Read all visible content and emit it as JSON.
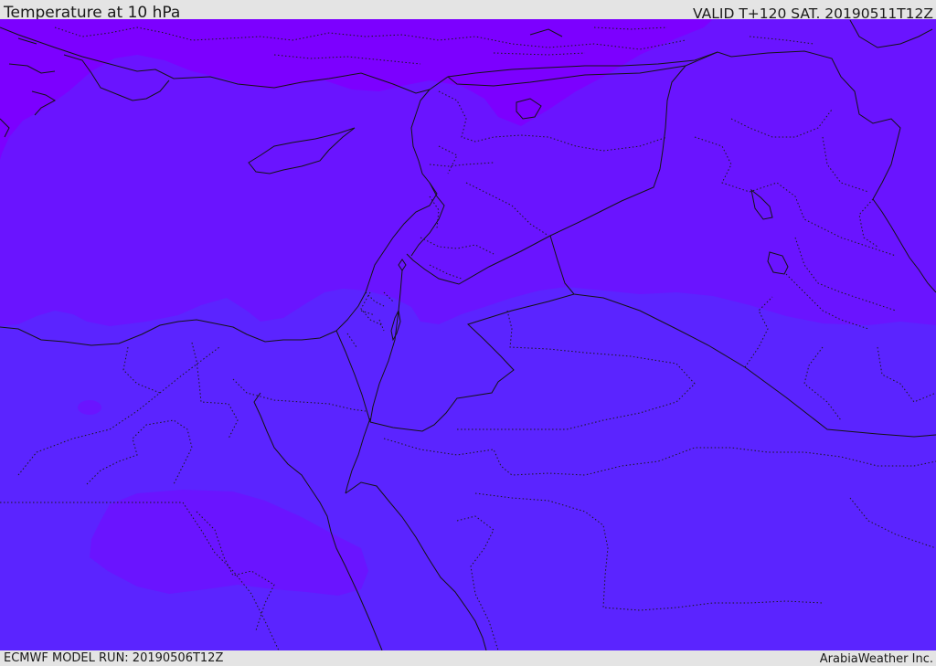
{
  "header": {
    "title": "Temperature at 10 hPa",
    "valid": "VALID T+120 SAT. 20190511T12Z"
  },
  "footer": {
    "model_run": "ECMWF MODEL RUN: 20190506T12Z",
    "credit": "ArabiaWeather Inc."
  },
  "map": {
    "field": "temperature",
    "level": "10 hPa",
    "fill_colors": {
      "top_band": "#7c00ff",
      "upper_band": "#6a14ff",
      "lower_band": "#5b24ff",
      "pocket": "#6a14ff"
    },
    "line_color": "#141414",
    "region": "Eastern Mediterranean and Middle East"
  }
}
